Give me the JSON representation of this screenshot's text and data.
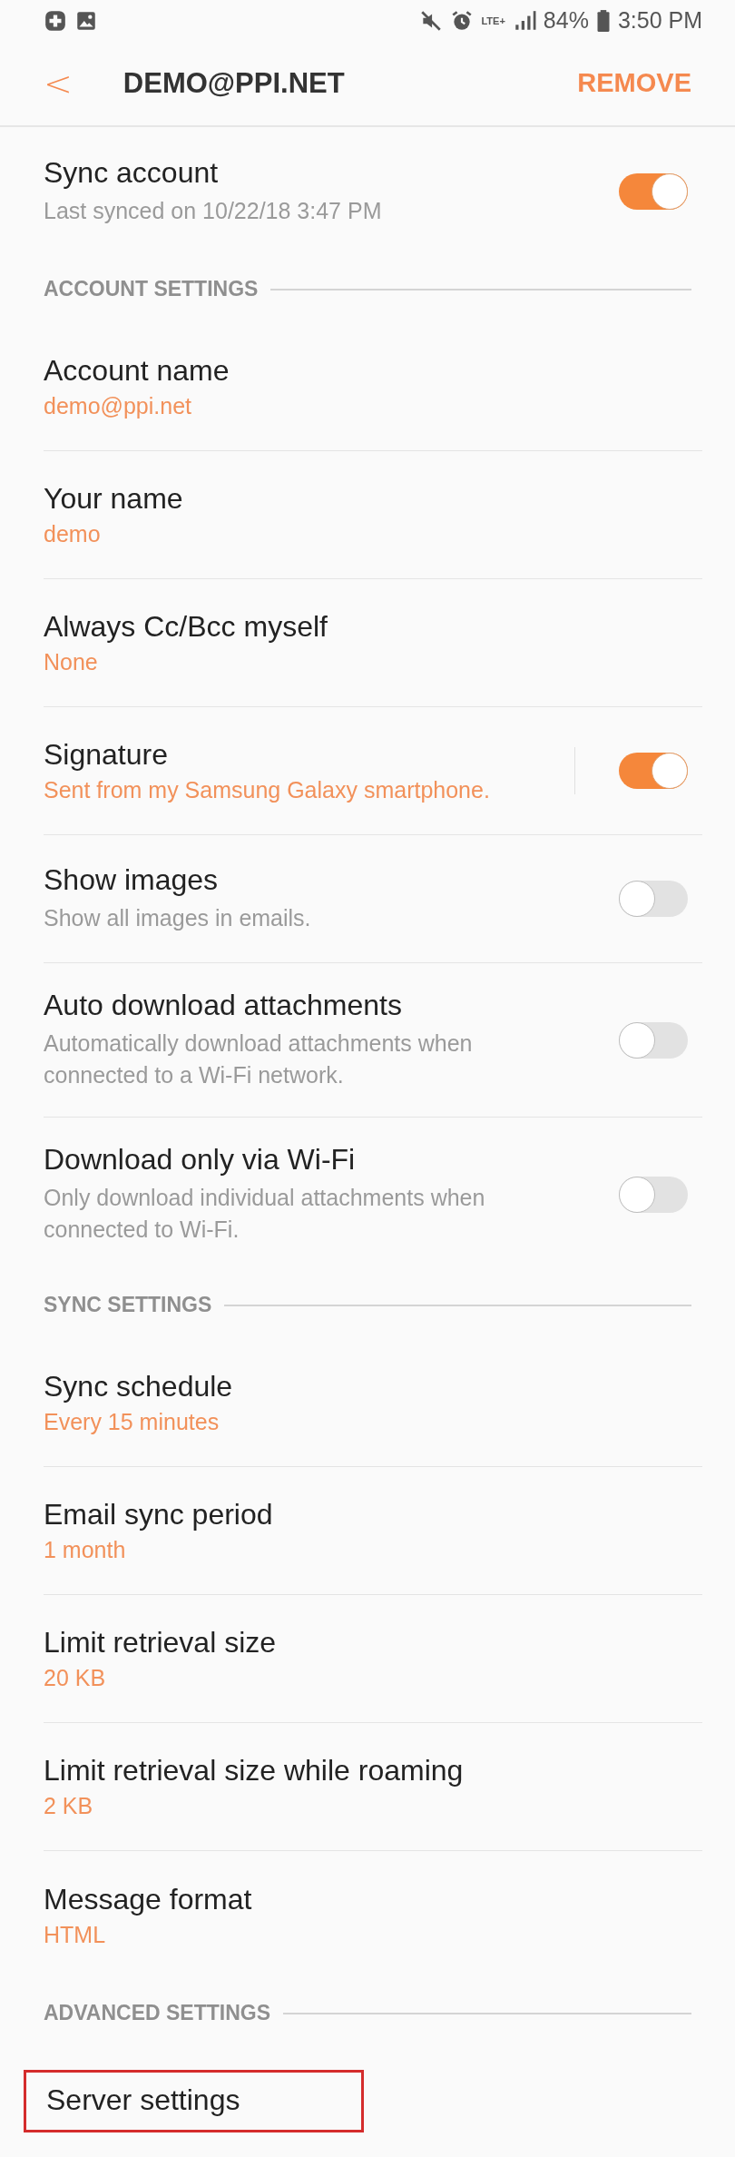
{
  "status_bar": {
    "network": "LTE+",
    "battery": "84%",
    "time": "3:50 PM"
  },
  "app_bar": {
    "back": "<",
    "title": "DEMO@PPI.NET",
    "action": "REMOVE"
  },
  "sections": [
    {
      "items": [
        {
          "kind": "toggle",
          "title": "Sync account",
          "description": "Last synced on 10/22/18  3:47 PM",
          "on": true
        }
      ]
    },
    {
      "title": "ACCOUNT SETTINGS",
      "items": [
        {
          "kind": "plain",
          "title": "Account name",
          "value": "demo@ppi.net"
        },
        {
          "kind": "plain",
          "title": "Your name",
          "value": "demo"
        },
        {
          "kind": "plain",
          "title": "Always Cc/Bcc myself",
          "value": "None"
        },
        {
          "kind": "toggle",
          "title": "Signature",
          "value": "Sent from my Samsung Galaxy smartphone.",
          "on": true,
          "split": true
        },
        {
          "kind": "toggle",
          "title": "Show images",
          "description": "Show all images in emails.",
          "on": false
        },
        {
          "kind": "toggle",
          "title": "Auto download attachments",
          "description": "Automatically download attachments when connected to a Wi-Fi network.",
          "on": false
        },
        {
          "kind": "toggle",
          "title": "Download only via Wi-Fi",
          "description": "Only download individual attachments when connected to Wi-Fi.",
          "on": false
        }
      ]
    },
    {
      "title": "SYNC SETTINGS",
      "items": [
        {
          "kind": "plain",
          "title": "Sync schedule",
          "value": "Every 15 minutes"
        },
        {
          "kind": "plain",
          "title": "Email sync period",
          "value": "1 month"
        },
        {
          "kind": "plain",
          "title": "Limit retrieval size",
          "value": "20 KB"
        },
        {
          "kind": "plain",
          "title": "Limit retrieval size while roaming",
          "value": "2 KB"
        },
        {
          "kind": "plain",
          "title": "Message format",
          "value": "HTML"
        }
      ]
    },
    {
      "title": "ADVANCED SETTINGS",
      "items": [
        {
          "kind": "plain",
          "title": "Server settings",
          "highlighted": true
        }
      ]
    }
  ]
}
